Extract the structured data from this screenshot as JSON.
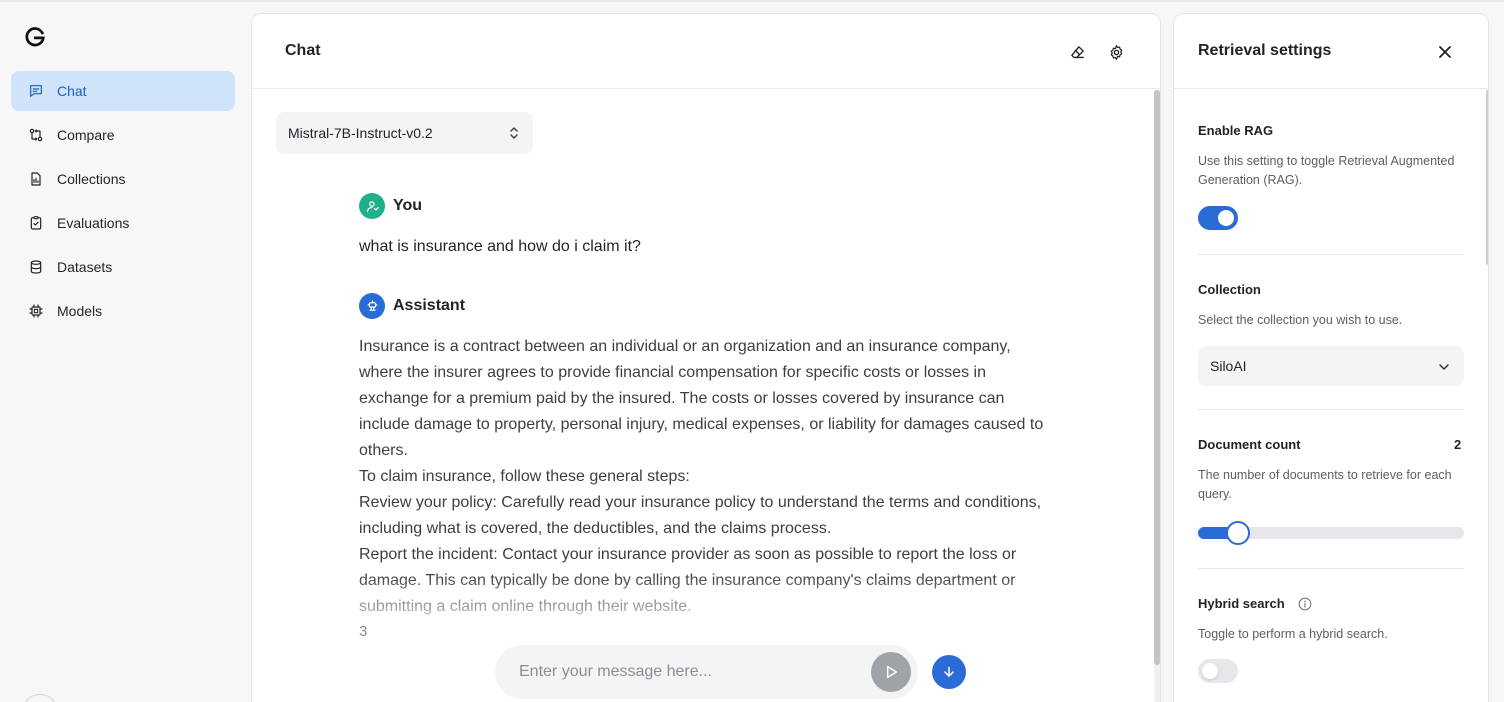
{
  "sidebar": {
    "items": [
      {
        "label": "Chat",
        "icon": "chat-icon",
        "active": true
      },
      {
        "label": "Compare",
        "icon": "compare-icon"
      },
      {
        "label": "Collections",
        "icon": "document-icon"
      },
      {
        "label": "Evaluations",
        "icon": "clipboard-check-icon"
      },
      {
        "label": "Datasets",
        "icon": "database-icon"
      },
      {
        "label": "Models",
        "icon": "cpu-chip-icon"
      }
    ]
  },
  "main": {
    "title": "Chat",
    "model": "Mistral-7B-Instruct-v0.2",
    "messages": [
      {
        "role": "You",
        "text": "what is insurance and how do i claim it?"
      },
      {
        "role": "Assistant",
        "paragraphs": [
          "Insurance is a contract between an individual or an organization and an insurance company, where the insurer agrees to provide financial compensation for specific costs or losses in exchange for a premium paid by the insured. The costs or losses covered by insurance can include damage to property, personal injury, medical expenses, or liability for damages caused to others.",
          "To claim insurance, follow these general steps:",
          "Review your policy: Carefully read your insurance policy to understand the terms and conditions, including what is covered, the deductibles, and the claims process.",
          "Report the incident: Contact your insurance provider as soon as possible to report the loss or damage. This can typically be done by calling the insurance company's claims department or submitting a claim online through their website.",
          "3"
        ]
      }
    ],
    "composer": {
      "placeholder": "Enter your message here..."
    }
  },
  "settings": {
    "title": "Retrieval settings",
    "enable_rag": {
      "label": "Enable RAG",
      "description": "Use this setting to toggle Retrieval Augmented Generation (RAG).",
      "on": true
    },
    "collection": {
      "label": "Collection",
      "description": "Select the collection you wish to use.",
      "value": "SiloAI"
    },
    "document_count": {
      "label": "Document count",
      "value": "2",
      "description": "The number of documents to retrieve for each query.",
      "fraction": 0.15
    },
    "hybrid_search": {
      "label": "Hybrid search",
      "description": "Toggle to perform a hybrid search.",
      "on": false
    }
  },
  "colors": {
    "accent": "#2b6bd6",
    "you_avatar": "#1db08b",
    "active_nav_bg": "#cfe4fa"
  }
}
